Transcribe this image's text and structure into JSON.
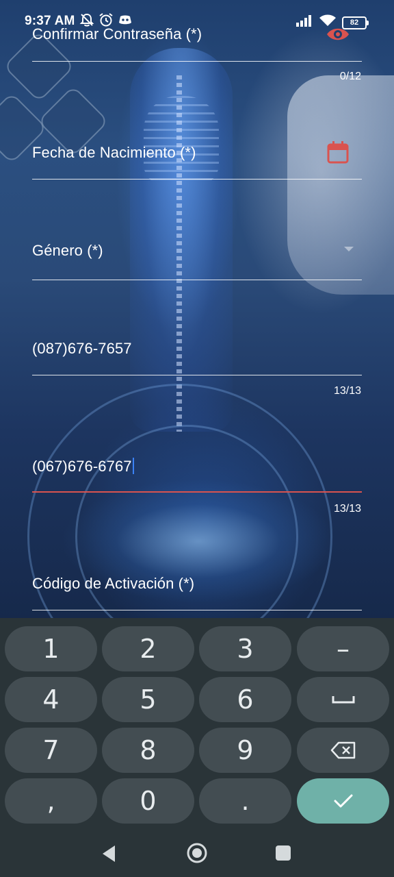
{
  "status_bar": {
    "time": "9:37 AM",
    "battery": "82",
    "icons": [
      "mute-bell-icon",
      "alarm-icon",
      "discord-icon",
      "signal-icon",
      "wifi-icon",
      "battery-icon"
    ]
  },
  "form": {
    "confirm_password": {
      "label": "Confirmar Contraseña (*)",
      "counter": "0/12",
      "icon": "eye-icon"
    },
    "birth_date": {
      "label": "Fecha de Nacimiento (*)",
      "icon": "calendar-icon"
    },
    "gender": {
      "label": "Género (*)",
      "icon": "dropdown-arrow-icon"
    },
    "phone_1": {
      "value": "(087)676-7657",
      "counter": "13/13"
    },
    "phone_2": {
      "value": "(067)676-6767",
      "counter": "13/13"
    },
    "activation_code": {
      "label": "Código de Activación (*)"
    }
  },
  "keyboard": {
    "rows": [
      [
        "1",
        "2",
        "3",
        "–"
      ],
      [
        "4",
        "5",
        "6",
        "␣"
      ],
      [
        "7",
        "8",
        "9",
        "⌫"
      ],
      [
        ",",
        "0",
        ".",
        "✓"
      ]
    ]
  },
  "colors": {
    "accent_red": "#d9534f",
    "keyboard_bg": "#2a3438",
    "key_bg": "#434d52",
    "confirm_key": "#6fb1a8"
  }
}
